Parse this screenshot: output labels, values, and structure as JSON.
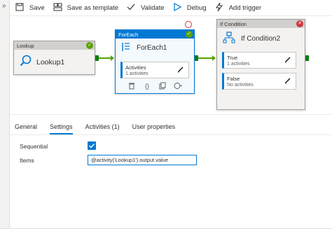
{
  "toolbar": {
    "save_label": "Save",
    "save_as_template_label": "Save as template",
    "validate_label": "Validate",
    "debug_label": "Debug",
    "add_trigger_label": "Add trigger"
  },
  "activities": {
    "lookup": {
      "type_label": "Lookup",
      "name": "Lookup1",
      "status": "succeeded"
    },
    "foreach": {
      "type_label": "ForEach",
      "name": "ForEach1",
      "status": "succeeded",
      "sub": {
        "title": "Activities",
        "count": "1 activities"
      }
    },
    "ifcondition": {
      "type_label": "If Condition",
      "name": "If Condition2",
      "status": "error",
      "true_branch": {
        "title": "True",
        "count": "1 activities"
      },
      "false_branch": {
        "title": "False",
        "count": "No activities"
      }
    }
  },
  "tabs": [
    {
      "label": "General",
      "active": false
    },
    {
      "label": "Settings",
      "active": true
    },
    {
      "label": "Activities (1)",
      "active": false
    },
    {
      "label": "User properties",
      "active": false
    }
  ],
  "settings": {
    "sequential_label": "Sequential",
    "sequential_checked": true,
    "items_label": "Items",
    "items_value": "@activity('Lookup1').output.value"
  },
  "colors": {
    "accent": "#0078d4",
    "success": "#57a300",
    "error": "#d13438"
  }
}
